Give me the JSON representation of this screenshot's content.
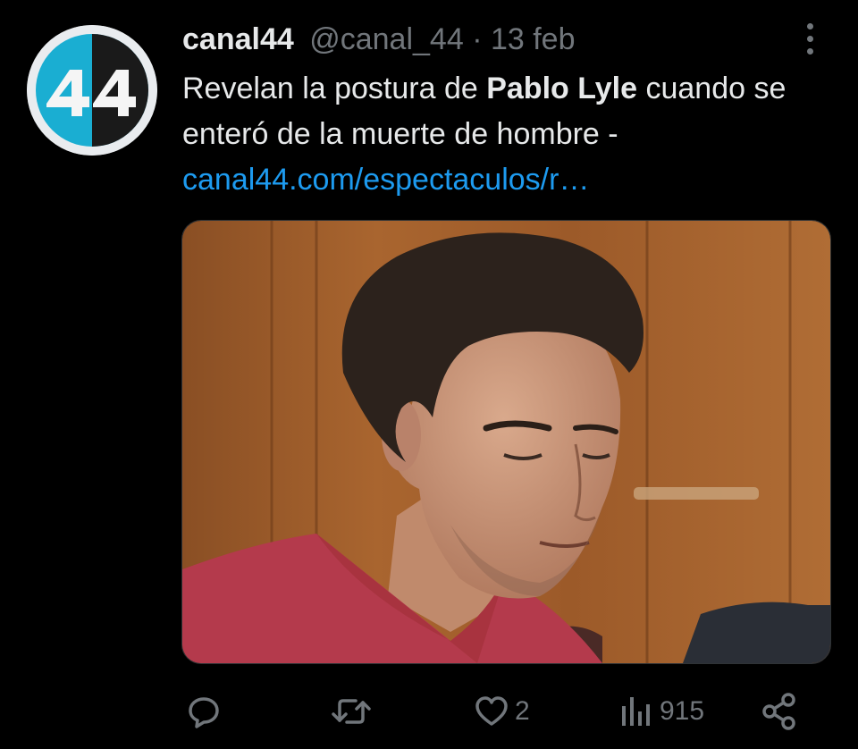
{
  "tweet": {
    "display_name": "canal44",
    "handle": "@canal_44",
    "separator": " · ",
    "date": "13 feb",
    "text_before": "Revelan la postura de ",
    "text_bold": "Pablo Lyle",
    "text_after": " cuando se enteró de la muerte de hombre -",
    "link": "canal44.com/espectaculos/r…",
    "avatar_logo_text": "44"
  },
  "actions": {
    "reply_icon": "reply-bubble-icon",
    "retweet_icon": "retweet-icon",
    "like_icon": "heart-icon",
    "like_count": "2",
    "views_icon": "bar-chart-icon",
    "views_count": "915",
    "share_icon": "share-icon"
  },
  "colors": {
    "background": "#000000",
    "text": "#e7e9ea",
    "muted": "#71767b",
    "link": "#1d9bf0",
    "avatar_cyan": "#1aaed2",
    "shirt": "#b43a4c"
  }
}
